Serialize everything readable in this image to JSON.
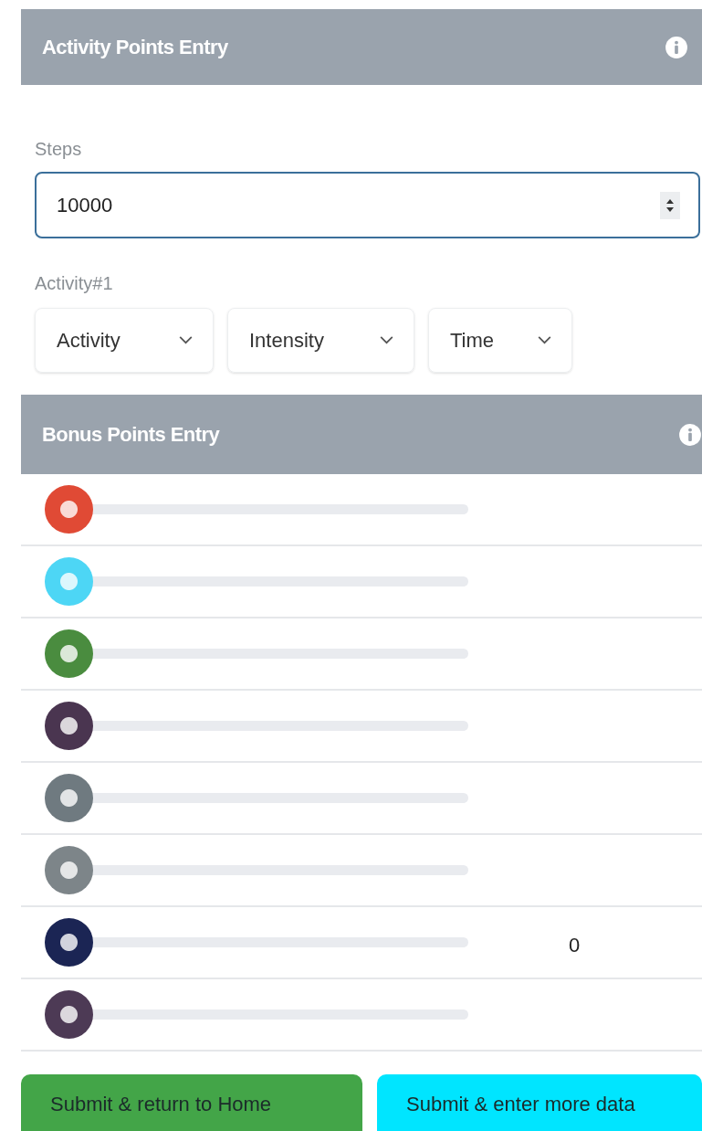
{
  "activity_section": {
    "title": "Activity Points Entry",
    "steps": {
      "label": "Steps",
      "value": "10000"
    },
    "activity_label": "Activity#1",
    "dropdowns": [
      {
        "label": "Activity"
      },
      {
        "label": "Intensity"
      },
      {
        "label": "Time"
      }
    ]
  },
  "bonus_section": {
    "title": "Bonus Points Entry",
    "sliders": [
      {
        "color": "#e04a35",
        "level": 0
      },
      {
        "color": "#4dd6f5",
        "level": 0
      },
      {
        "color": "#4a8c3f",
        "level": 0
      },
      {
        "color": "#4a3550",
        "level": 0
      },
      {
        "color": "#6f7a80",
        "level": 0
      },
      {
        "color": "#7d8589",
        "level": 0
      },
      {
        "color": "#1b2554",
        "level": 0,
        "value": "0"
      },
      {
        "color": "#4d3a55",
        "level": 0
      }
    ]
  },
  "buttons": [
    {
      "kind": "home",
      "label": "Submit & return to Home"
    },
    {
      "kind": "more",
      "label": "Submit & enter more data"
    }
  ]
}
